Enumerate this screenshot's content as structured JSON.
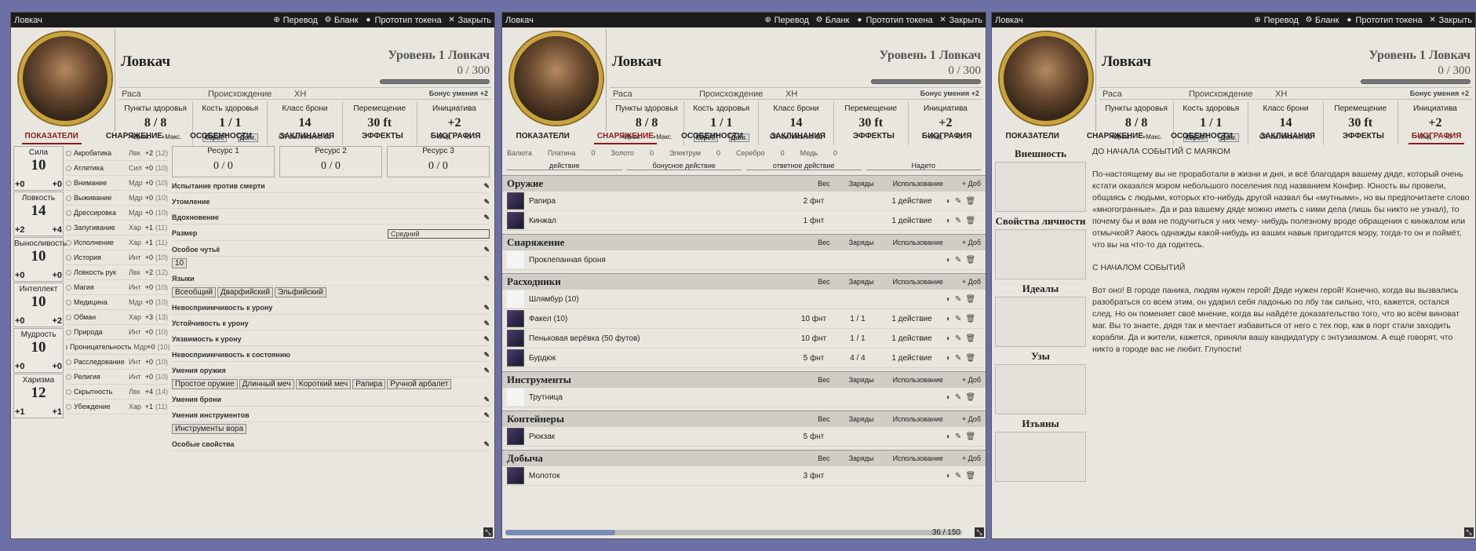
{
  "window": {
    "title": "Ловкач",
    "actions": [
      "Перевод",
      "Бланк",
      "Прототип токена",
      "Закрыть"
    ]
  },
  "header": {
    "name": "Ловкач",
    "level": "Уровень 1 Ловкач",
    "xp": "0 / 300",
    "race": "Раса",
    "background": "Происхождение",
    "alignment": "ХН",
    "prof_bonus": "Бонус умения +2"
  },
  "stats": [
    {
      "label": "Пункты здоровья",
      "value": "8 / 8",
      "sub1": "+Врем.",
      "sub2": "+Макс."
    },
    {
      "label": "Кость здоровья",
      "value": "1 / 1",
      "sub1": "Корот.",
      "sub2": "Долг."
    },
    {
      "label": "Класс брони",
      "value": "14",
      "sub1": "СЛ заклинаний 10",
      "sub2": ""
    },
    {
      "label": "Перемещение",
      "value": "30 ft",
      "sub1": "",
      "sub2": ""
    },
    {
      "label": "Инициатива",
      "value": "+2",
      "sub1": "Мод.",
      "sub2": "+0"
    }
  ],
  "tabs": [
    "ПОКАЗАТЕЛИ",
    "СНАРЯЖЕНИЕ",
    "ОСОБЕННОСТИ",
    "ЗАКЛИНАНИЯ",
    "ЭФФЕКТЫ",
    "БИОГРАФИЯ"
  ],
  "abilities": [
    {
      "name": "Сила",
      "value": "10",
      "mod": "+0",
      "save": "+0"
    },
    {
      "name": "Ловкость",
      "value": "14",
      "mod": "+2",
      "save": "+4"
    },
    {
      "name": "Выносливость",
      "value": "10",
      "mod": "+0",
      "save": "+0"
    },
    {
      "name": "Интеллект",
      "value": "10",
      "mod": "+0",
      "save": "+2"
    },
    {
      "name": "Мудрость",
      "value": "10",
      "mod": "+0",
      "save": "+0"
    },
    {
      "name": "Харизма",
      "value": "12",
      "mod": "+1",
      "save": "+1"
    }
  ],
  "skills": [
    {
      "n": "Акробатика",
      "a": "Лвк",
      "b": "+2",
      "p": "(12)"
    },
    {
      "n": "Атлетика",
      "a": "Сил",
      "b": "+0",
      "p": "(10)"
    },
    {
      "n": "Внимание",
      "a": "Мдр",
      "b": "+0",
      "p": "(10)"
    },
    {
      "n": "Выживание",
      "a": "Мдр",
      "b": "+0",
      "p": "(10)"
    },
    {
      "n": "Дрессировка",
      "a": "Мдр",
      "b": "+0",
      "p": "(10)"
    },
    {
      "n": "Запугивание",
      "a": "Хар",
      "b": "+1",
      "p": "(11)"
    },
    {
      "n": "Исполнение",
      "a": "Хар",
      "b": "+1",
      "p": "(11)"
    },
    {
      "n": "История",
      "a": "Инт",
      "b": "+0",
      "p": "(10)"
    },
    {
      "n": "Ловкость рук",
      "a": "Лвк",
      "b": "+2",
      "p": "(12)"
    },
    {
      "n": "Магия",
      "a": "Инт",
      "b": "+0",
      "p": "(10)"
    },
    {
      "n": "Медицина",
      "a": "Мдр",
      "b": "+0",
      "p": "(10)"
    },
    {
      "n": "Обман",
      "a": "Хар",
      "b": "+3",
      "p": "(13)"
    },
    {
      "n": "Природа",
      "a": "Инт",
      "b": "+0",
      "p": "(10)"
    },
    {
      "n": "Проницательность",
      "a": "Мдр",
      "b": "+0",
      "p": "(10)"
    },
    {
      "n": "Расследование",
      "a": "Инт",
      "b": "+0",
      "p": "(10)"
    },
    {
      "n": "Религия",
      "a": "Инт",
      "b": "+0",
      "p": "(10)"
    },
    {
      "n": "Скрытность",
      "a": "Лвк",
      "b": "+4",
      "p": "(14)"
    },
    {
      "n": "Убеждение",
      "a": "Хар",
      "b": "+1",
      "p": "(11)"
    }
  ],
  "resources": [
    "Ресурс 1",
    "Ресурс 2",
    "Ресурс 3"
  ],
  "res_value": "0 / 0",
  "misc": {
    "death_saves": "Испытание против смерти",
    "exhaustion": "Утомление",
    "inspiration": "Вдохновение",
    "size_label": "Размер",
    "size_value": "Средний",
    "special": "Особое чутьё",
    "special_val": "10",
    "languages": "Языки",
    "lang_list": [
      "Всеобщий",
      "Дварфийский",
      "Эльфийский"
    ],
    "dmg_imm": "Невосприимчивость к урону",
    "dmg_res": "Устойчивость к урону",
    "dmg_vul": "Уязвимость к урону",
    "cond_imm": "Невосприимчивость к состоянию",
    "weapons": "Умения оружия",
    "weapon_list": [
      "Простое оружие",
      "Длинный меч",
      "Короткий меч",
      "Рапира",
      "Ручной арбалет"
    ],
    "armor": "Умения брони",
    "tools": "Умения инструментов",
    "tool_list": [
      "Инструменты вора"
    ],
    "special_props": "Особые свойства"
  },
  "inventory": {
    "currency_label": "Валюта",
    "currencies": [
      [
        "Платина",
        "0"
      ],
      [
        "Золото",
        "0"
      ],
      [
        "Электрум",
        "0"
      ],
      [
        "Серебро",
        "0"
      ],
      [
        "Медь",
        "0"
      ]
    ],
    "actions": [
      "действие",
      "бонусное действие",
      "ответное действие",
      "Надето"
    ],
    "cols": [
      "Вес",
      "Заряды",
      "Использование",
      "+ Доб"
    ],
    "sections": [
      {
        "name": "Оружие",
        "items": [
          {
            "n": "Рапира",
            "w": "2 фнт",
            "c": "",
            "u": "1 действие"
          },
          {
            "n": "Кинжал",
            "w": "1 фнт",
            "c": "",
            "u": "1 действие"
          }
        ]
      },
      {
        "name": "Снаряжение",
        "items": [
          {
            "n": "Проклепанная броня",
            "w": "",
            "c": "",
            "u": ""
          }
        ]
      },
      {
        "name": "Расходники",
        "items": [
          {
            "n": "Шлямбур (10)",
            "w": "",
            "c": "",
            "u": ""
          },
          {
            "n": "Факел (10)",
            "w": "10 фнт",
            "c": "1 / 1",
            "u": "1 действие"
          },
          {
            "n": "Пеньковая верёвка (50 футов)",
            "w": "10 фнт",
            "c": "1 / 1",
            "u": "1 действие"
          },
          {
            "n": "Бурдюк",
            "w": "5 фнт",
            "c": "4 / 4",
            "u": "1 действие"
          }
        ]
      },
      {
        "name": "Инструменты",
        "items": [
          {
            "n": "Трутница",
            "w": "",
            "c": "",
            "u": ""
          }
        ]
      },
      {
        "name": "Контейнеры",
        "items": [
          {
            "n": "Рюкзак",
            "w": "5 фнт",
            "c": "",
            "u": ""
          }
        ]
      },
      {
        "name": "Добыча",
        "items": [
          {
            "n": "Молоток",
            "w": "3 фнт",
            "c": "",
            "u": ""
          }
        ]
      }
    ],
    "weight": "36 / 150"
  },
  "bio": {
    "sections": [
      "Внешность",
      "Свойства личности",
      "Идеалы",
      "Узы",
      "Изъяны"
    ],
    "h1": "ДО НАЧАЛА СОБЫТИЙ С МАЯКОМ",
    "p1": "По-настоящему вы не проработали в жизни и дня, и всё благодаря вашему дяде, который очень кстати оказался мэром небольшого поселения под названием Конфир. Юность вы провели, общаясь с людьми, которых кто-нибудь другой назвал бы «мутными», но вы предпочитаете слово «многогранные». Да и раз вашему дяде можно иметь с ними дела (лишь бы никто не узнал), то почему бы и вам не подучиться у них чему- нибудь полезному вроде обращения с кинжалом или отмычкой? Авось однажды какой-нибудь из ваших навык пригодится мэру, тогда-то он и поймёт, что вы на что-то да годитесь.",
    "h2": "С НАЧАЛОМ СОБЫТИЙ",
    "p2": "Вот оно! В городе паника, людям нужен герой! Дяде нужен герой! Конечно, когда вы вызвались разобраться со всем этим, он ударил себя ладонью по лбу так сильно, что, кажется, остался след. Но он поменяет своё мнение, когда вы найдёте доказательство того, что во всём виноват маг. Вы то знаете, дядя так и мечтает избавиться от него с тех пор, как в порт стали заходить корабли. Да и жители, кажется, приняли вашу кандидатуру с энтузиазмом. А ещё говорят, что никто в городе вас не любит. Глупости!"
  }
}
